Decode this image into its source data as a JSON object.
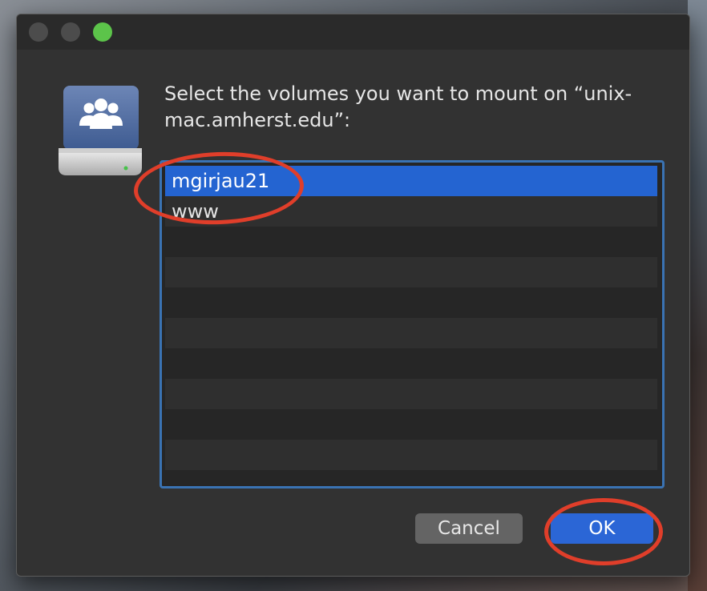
{
  "dialog": {
    "message": "Select the volumes you want to mount on “unix-mac.amherst.edu”:",
    "icon": "network-volume-icon"
  },
  "volumes": {
    "items": [
      {
        "label": "mgirjau21",
        "selected": true
      },
      {
        "label": "www",
        "selected": false
      }
    ],
    "empty_rows": 8
  },
  "buttons": {
    "cancel_label": "Cancel",
    "ok_label": "OK"
  },
  "colors": {
    "selection": "#2464d1",
    "annotation": "#e03e2a",
    "zoom_light": "#5cc44a"
  }
}
